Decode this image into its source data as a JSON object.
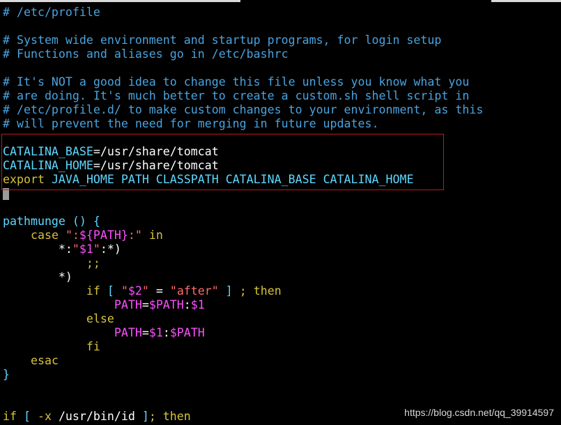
{
  "editor": {
    "lines": [
      [
        {
          "t": "# /etc/profile",
          "c": "comment"
        }
      ],
      [],
      [
        {
          "t": "# System wide environment and startup programs, for login setup",
          "c": "comment"
        }
      ],
      [
        {
          "t": "# Functions and aliases go in /etc/bashrc",
          "c": "comment"
        }
      ],
      [],
      [
        {
          "t": "# It's NOT a good idea to change this file unless you know what you",
          "c": "comment"
        }
      ],
      [
        {
          "t": "# are doing. It's much better to create a custom.sh shell script in",
          "c": "comment"
        }
      ],
      [
        {
          "t": "# /etc/profile.d/ to make custom changes to your environment, as this",
          "c": "comment"
        }
      ],
      [
        {
          "t": "# will prevent the need for merging in future updates.",
          "c": "comment"
        }
      ],
      [],
      [
        {
          "t": "CATALINA_BASE",
          "c": "var"
        },
        {
          "t": "=/usr/share/tomcat",
          "c": "plain"
        }
      ],
      [
        {
          "t": "CATALINA_HOME",
          "c": "var"
        },
        {
          "t": "=/usr/share/tomcat",
          "c": "plain"
        }
      ],
      [
        {
          "t": "export",
          "c": "keyword"
        },
        {
          "t": " JAVA_HOME PATH CLASSPATH CATALINA_BASE CATALINA_HOME",
          "c": "var"
        }
      ],
      [
        {
          "cursor": true
        }
      ],
      [],
      [
        {
          "t": "pathmunge () {",
          "c": "func"
        }
      ],
      [
        {
          "t": "    ",
          "c": "plain"
        },
        {
          "t": "case",
          "c": "keyword"
        },
        {
          "t": " ",
          "c": "plain"
        },
        {
          "t": "\":",
          "c": "string"
        },
        {
          "t": "${PATH}",
          "c": "subst"
        },
        {
          "t": ":\"",
          "c": "string"
        },
        {
          "t": " in",
          "c": "keyword"
        }
      ],
      [
        {
          "t": "        *:",
          "c": "plain"
        },
        {
          "t": "\"",
          "c": "string"
        },
        {
          "t": "$1",
          "c": "subst"
        },
        {
          "t": "\"",
          "c": "string"
        },
        {
          "t": ":*)",
          "c": "plain"
        }
      ],
      [
        {
          "t": "            ;;",
          "c": "keyword"
        }
      ],
      [
        {
          "t": "        *)",
          "c": "plain"
        }
      ],
      [
        {
          "t": "            ",
          "c": "plain"
        },
        {
          "t": "if",
          "c": "keyword"
        },
        {
          "t": " [ ",
          "c": "op"
        },
        {
          "t": "\"",
          "c": "string"
        },
        {
          "t": "$2",
          "c": "subst"
        },
        {
          "t": "\"",
          "c": "string"
        },
        {
          "t": " = ",
          "c": "plain"
        },
        {
          "t": "\"after\"",
          "c": "string"
        },
        {
          "t": " ] ",
          "c": "op"
        },
        {
          "t": "; then",
          "c": "keyword"
        }
      ],
      [
        {
          "t": "                ",
          "c": "plain"
        },
        {
          "t": "PATH",
          "c": "subst"
        },
        {
          "t": "=",
          "c": "plain"
        },
        {
          "t": "$PATH",
          "c": "subst"
        },
        {
          "t": ":",
          "c": "plain"
        },
        {
          "t": "$1",
          "c": "subst"
        }
      ],
      [
        {
          "t": "            ",
          "c": "plain"
        },
        {
          "t": "else",
          "c": "keyword"
        }
      ],
      [
        {
          "t": "                ",
          "c": "plain"
        },
        {
          "t": "PATH",
          "c": "subst"
        },
        {
          "t": "=",
          "c": "plain"
        },
        {
          "t": "$1",
          "c": "subst"
        },
        {
          "t": ":",
          "c": "plain"
        },
        {
          "t": "$PATH",
          "c": "subst"
        }
      ],
      [
        {
          "t": "            ",
          "c": "plain"
        },
        {
          "t": "fi",
          "c": "keyword"
        }
      ],
      [
        {
          "t": "    ",
          "c": "plain"
        },
        {
          "t": "esac",
          "c": "keyword"
        }
      ],
      [
        {
          "t": "}",
          "c": "func"
        }
      ],
      [],
      [],
      [
        {
          "t": "if",
          "c": "keyword"
        },
        {
          "t": " [ ",
          "c": "op"
        },
        {
          "t": "-x",
          "c": "keyword"
        },
        {
          "t": " /usr/bin/id ",
          "c": "plain"
        },
        {
          "t": "]",
          "c": "op"
        },
        {
          "t": "; then",
          "c": "keyword"
        }
      ]
    ]
  },
  "watermark": {
    "text": "https://blog.csdn.net/qq_39914597"
  },
  "colors": {
    "background": "#000000",
    "comment": "#4aa3df",
    "keyword": "#d7c23a",
    "variable": "#5fd7ff",
    "string": "#ff6b6b",
    "substitution": "#ff4fff",
    "highlight_box": "#c0191e"
  }
}
